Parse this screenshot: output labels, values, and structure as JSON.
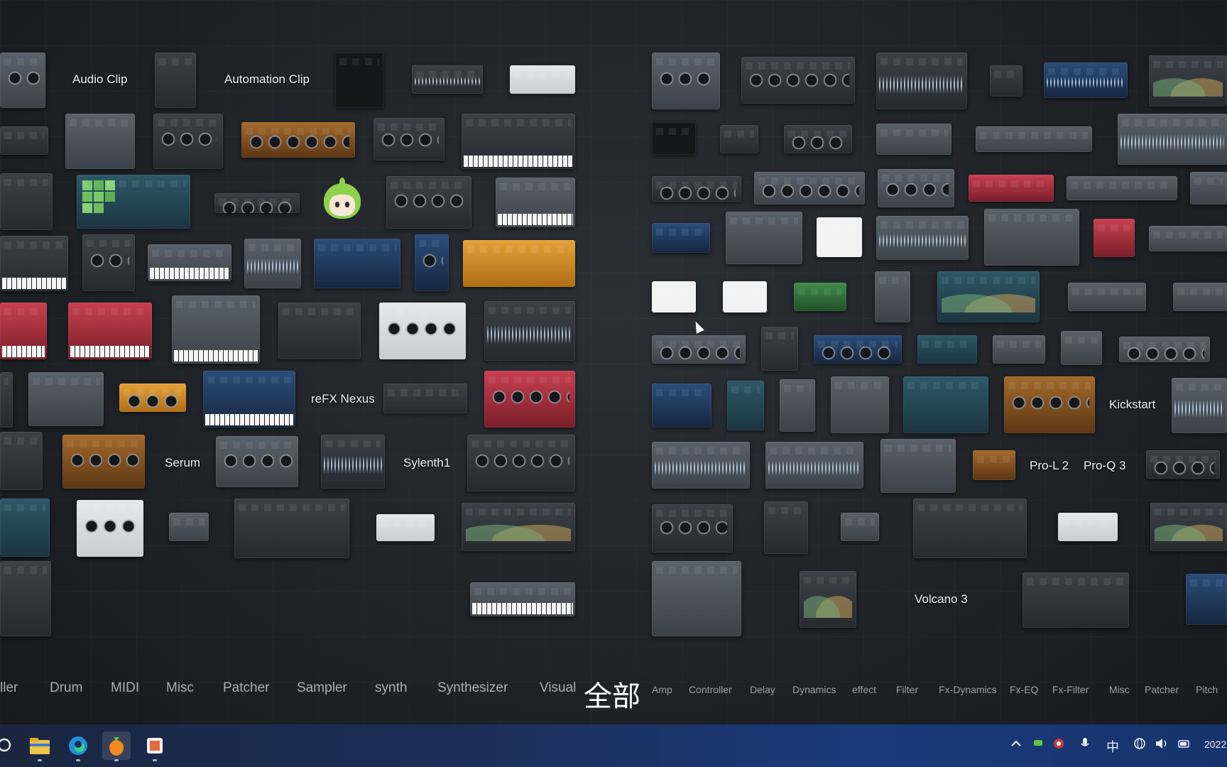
{
  "plugin_labels": {
    "audio_clip": "Audio Clip",
    "automation_clip": "Automation Clip",
    "refx_nexus": "reFX Nexus",
    "serum": "Serum",
    "sylenth1": "Sylenth1",
    "kickstart": "Kickstart",
    "pro_l2": "Pro-L 2",
    "pro_q3": "Pro-Q 3",
    "volcano3": "Volcano 3"
  },
  "generator_categories": [
    "ller",
    "Drum",
    "MIDI",
    "Misc",
    "Patcher",
    "Sampler",
    "synth",
    "Synthesizer",
    "Visual"
  ],
  "active_category": "全部",
  "effect_categories": [
    "Amp",
    "Controller",
    "Delay",
    "Dynamics",
    "effect",
    "Filter",
    "Fx-Dynamics",
    "Fx-EQ",
    "Fx-Filter",
    "Misc",
    "Patcher",
    "Pitch"
  ],
  "taskbar": {
    "apps": [
      "search-icon",
      "file-explorer-icon",
      "edge-icon",
      "fl-studio-icon",
      "media-player-icon"
    ],
    "tray": {
      "ime": "中",
      "clock": "2022"
    }
  }
}
